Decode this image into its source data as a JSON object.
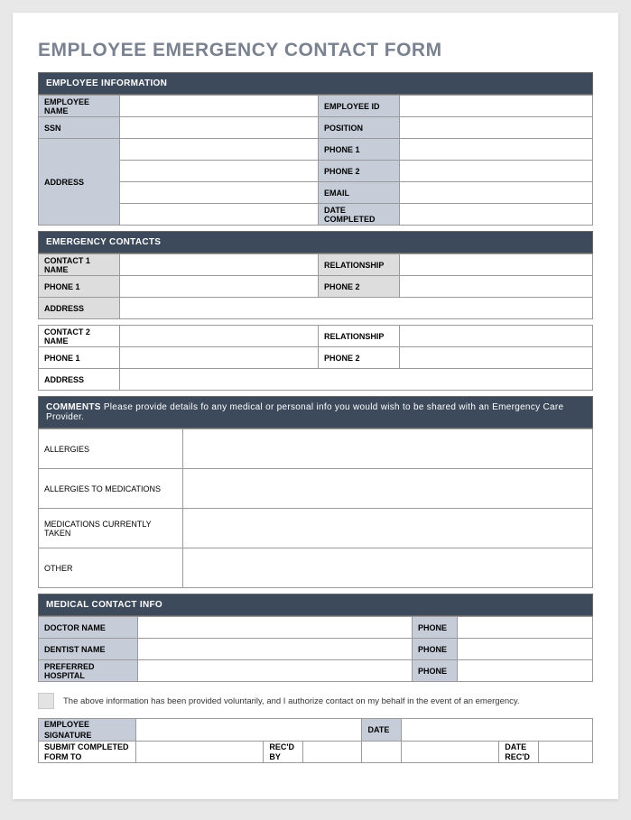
{
  "title": "EMPLOYEE EMERGENCY CONTACT FORM",
  "sections": {
    "employee": {
      "header": "EMPLOYEE INFORMATION",
      "labels": {
        "name": "EMPLOYEE NAME",
        "id": "EMPLOYEE ID",
        "ssn": "SSN",
        "position": "POSITION",
        "address": "ADDRESS",
        "phone1": "PHONE 1",
        "phone2": "PHONE 2",
        "email": "EMAIL",
        "date_completed": "DATE COMPLETED"
      }
    },
    "contacts": {
      "header": "EMERGENCY CONTACTS",
      "labels": {
        "c1name": "CONTACT 1 NAME",
        "c2name": "CONTACT 2 NAME",
        "relationship": "RELATIONSHIP",
        "phone1": "PHONE 1",
        "phone2": "PHONE 2",
        "address": "ADDRESS"
      }
    },
    "comments": {
      "header_bold": "COMMENTS",
      "header_rest": " Please provide details fo any medical or personal info you would wish to be shared with an Emergency Care Provider.",
      "labels": {
        "allergies": "ALLERGIES",
        "allergies_meds": "ALLERGIES TO MEDICATIONS",
        "meds_current": "MEDICATIONS CURRENTLY TAKEN",
        "other": "OTHER"
      }
    },
    "medical": {
      "header": "MEDICAL CONTACT INFO",
      "labels": {
        "doctor": "DOCTOR NAME",
        "dentist": "DENTIST NAME",
        "hospital": "PREFERRED HOSPITAL",
        "phone": "PHONE"
      }
    },
    "auth": {
      "text": "The above information has been provided voluntarily, and I authorize contact on my behalf in the event of an emergency.",
      "labels": {
        "signature": "EMPLOYEE SIGNATURE",
        "date": "DATE",
        "submit_to": "SUBMIT COMPLETED FORM TO",
        "recd_by": "REC'D BY",
        "date_recd": "DATE REC'D"
      }
    }
  }
}
